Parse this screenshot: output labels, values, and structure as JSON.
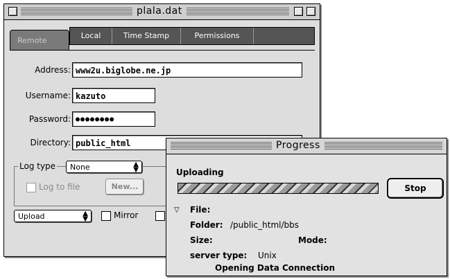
{
  "main_window": {
    "title": "plala.dat",
    "tabs": {
      "active": "Remote",
      "others": [
        "Local",
        "Time Stamp",
        "Permissions"
      ]
    },
    "fields": {
      "address_label": "Address:",
      "address_value": "www2u.biglobe.ne.jp",
      "username_label": "Username:",
      "username_value": "kazuto",
      "password_label": "Password:",
      "password_value": "●●●●●●●●",
      "directory_label": "Directory:",
      "directory_value": "public_html"
    },
    "log": {
      "group_label": "Log type",
      "type_value": "None",
      "log_to_file_label": "Log to file",
      "new_button": "New..."
    },
    "bottom": {
      "mode_value": "Upload",
      "mirror_label": "Mirror"
    }
  },
  "progress_window": {
    "title": "Progress",
    "status": "Uploading",
    "stop_button": "Stop",
    "file_label": "File:",
    "folder_label": "Folder:",
    "folder_value": "/public_html/bbs",
    "size_label": "Size:",
    "mode_label": "Mode:",
    "server_type_label": "server type:",
    "server_type_value": "Unix",
    "message": "Opening Data Connection"
  }
}
